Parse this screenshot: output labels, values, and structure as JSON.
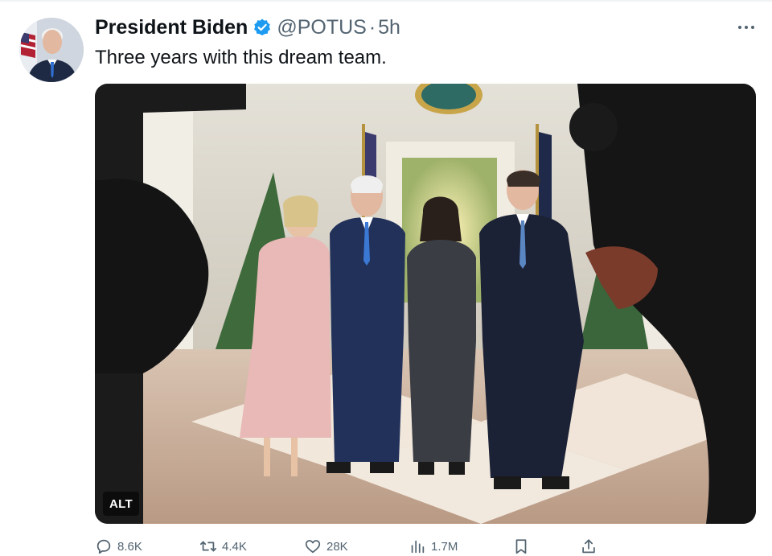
{
  "tweet": {
    "author": {
      "display_name": "President Biden",
      "verified_icon": "verified-badge-icon",
      "handle": "@POTUS",
      "separator": "·",
      "time": "5h"
    },
    "more_icon": "more-horizontal-icon",
    "text": "Three years with this dream team.",
    "media": {
      "alt_label": "ALT"
    },
    "actions": {
      "replies": "8.6K",
      "reposts": "4.4K",
      "likes": "28K",
      "views": "1.7M"
    }
  },
  "colors": {
    "text_primary": "#0f1419",
    "text_secondary": "#536471",
    "verified_blue": "#1d9bf0",
    "divider": "#eff3f4"
  }
}
